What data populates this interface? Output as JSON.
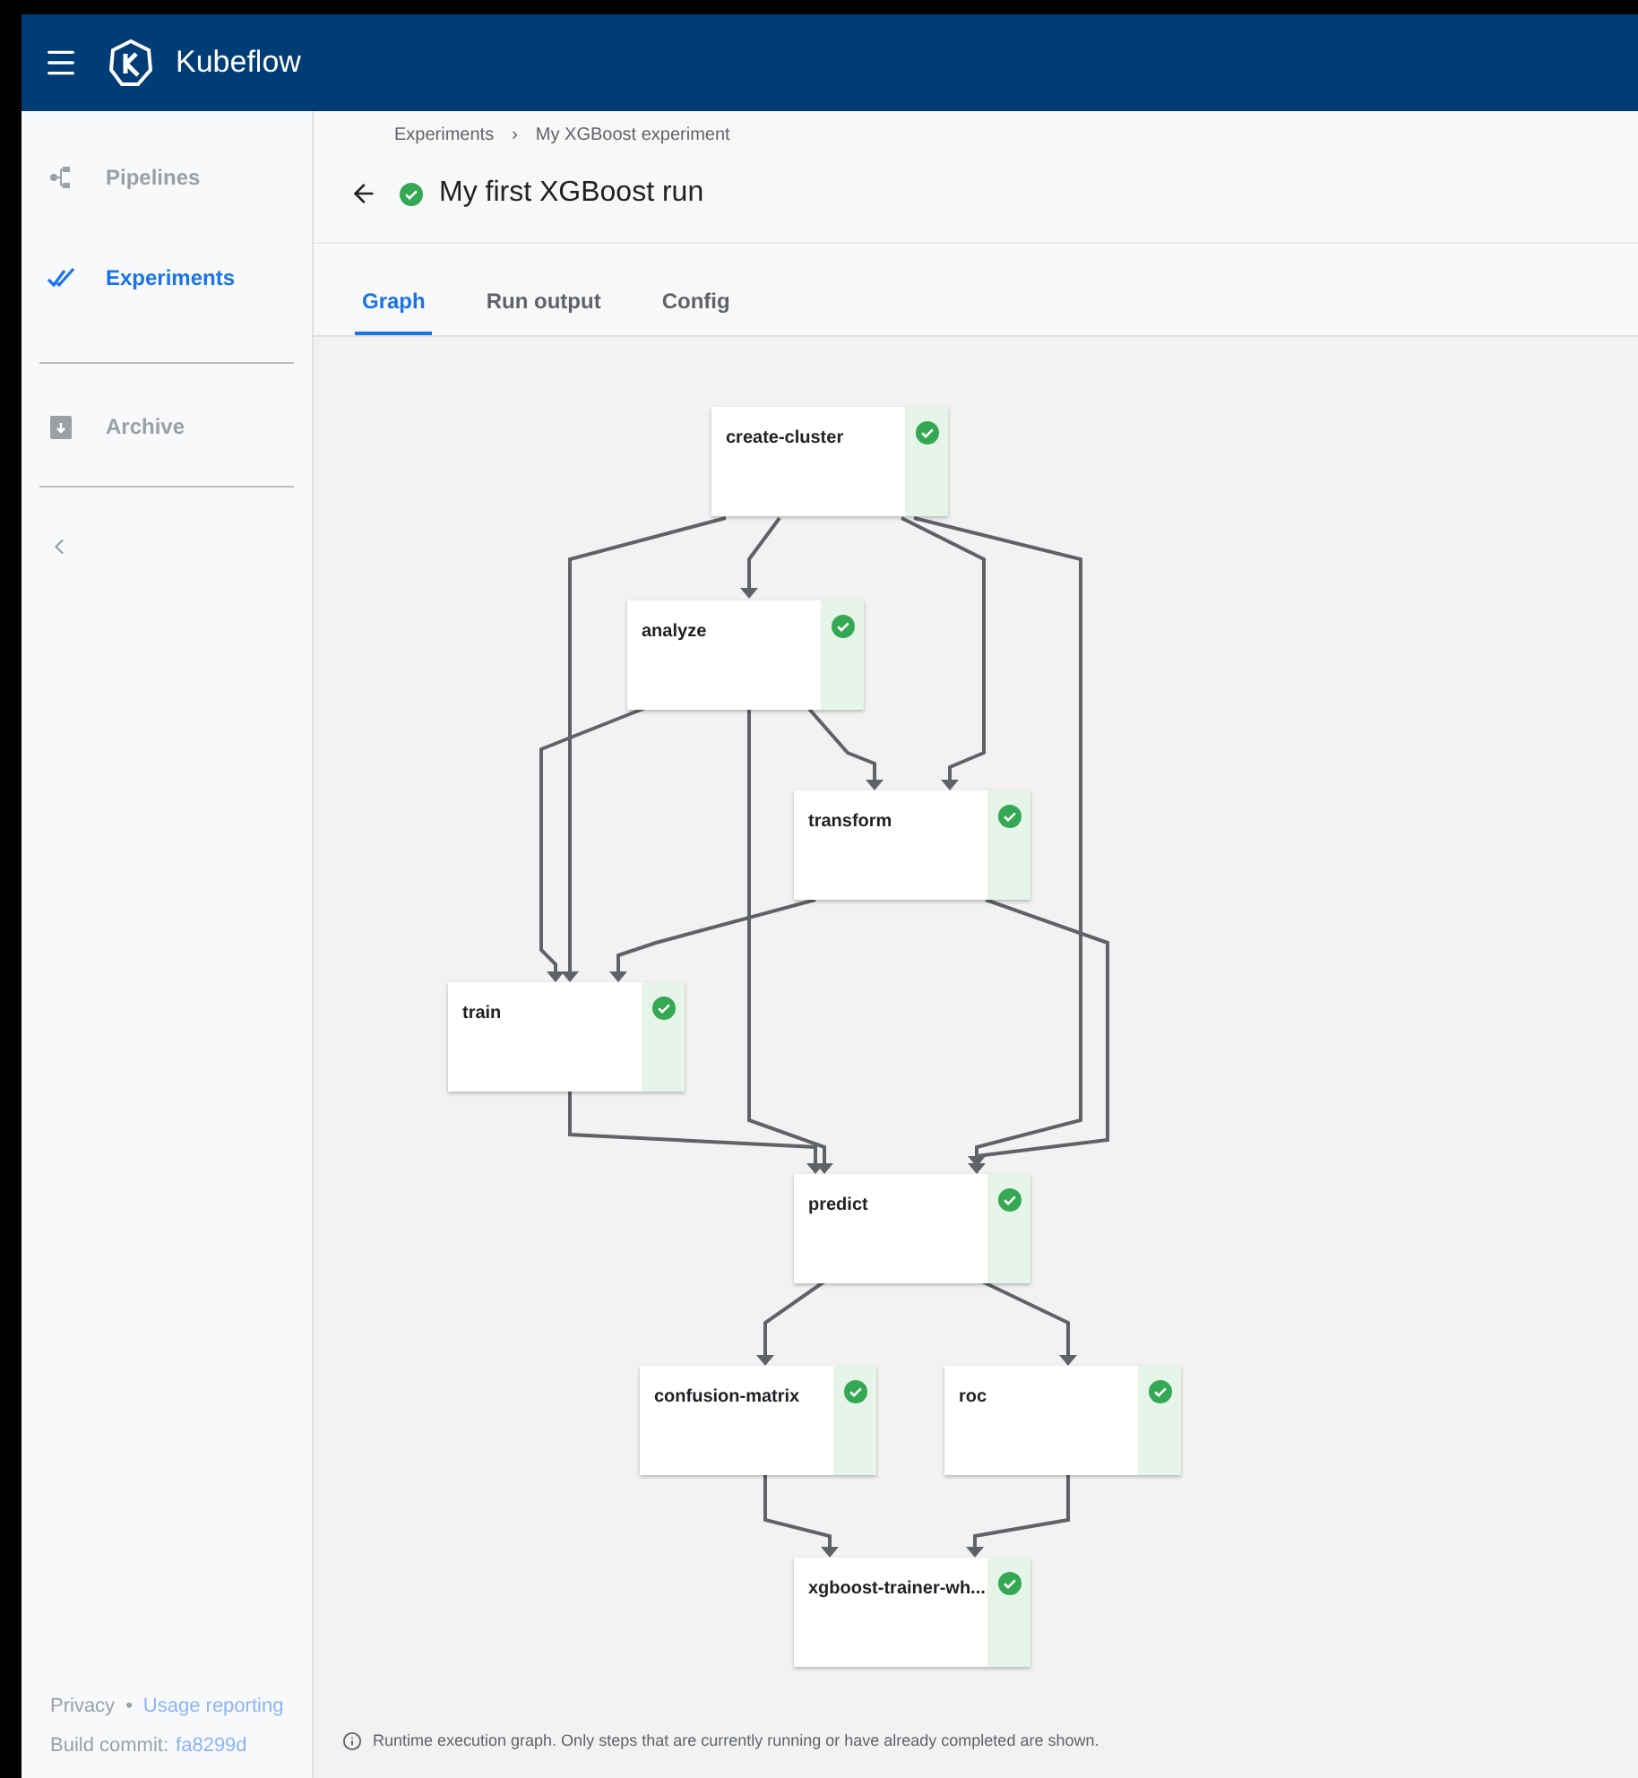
{
  "header": {
    "title": "Kubeflow"
  },
  "sidebar": {
    "items": [
      {
        "label": "Pipelines",
        "kind": "pipelines",
        "selected": false
      },
      {
        "label": "Experiments",
        "kind": "experiments",
        "selected": true
      },
      {
        "label": "Archive",
        "kind": "archive",
        "selected": false
      }
    ],
    "footer": {
      "privacy": "Privacy",
      "separator": "•",
      "usage": "Usage reporting",
      "build_label": "Build commit:",
      "build_commit": "fa8299d"
    }
  },
  "breadcrumbs": [
    "Experiments",
    "My XGBoost experiment"
  ],
  "breadcrumb_separator": "›",
  "run": {
    "title": "My first XGBoost run",
    "succeeded": true
  },
  "tabs": [
    {
      "label": "Graph",
      "selected": true
    },
    {
      "label": "Run output",
      "selected": false
    },
    {
      "label": "Config",
      "selected": false
    }
  ],
  "graph": {
    "nodes": [
      {
        "name": "create-cluster",
        "succeeded": true
      },
      {
        "name": "analyze",
        "succeeded": true
      },
      {
        "name": "transform",
        "succeeded": true
      },
      {
        "name": "train",
        "succeeded": true
      },
      {
        "name": "predict",
        "succeeded": true
      },
      {
        "name": "confusion-matrix",
        "succeeded": true
      },
      {
        "name": "roc",
        "succeeded": true
      },
      {
        "name": "xgboost-trainer-wh...",
        "succeeded": true
      }
    ],
    "note": "Runtime execution graph. Only steps that are currently running or have already completed are shown."
  }
}
